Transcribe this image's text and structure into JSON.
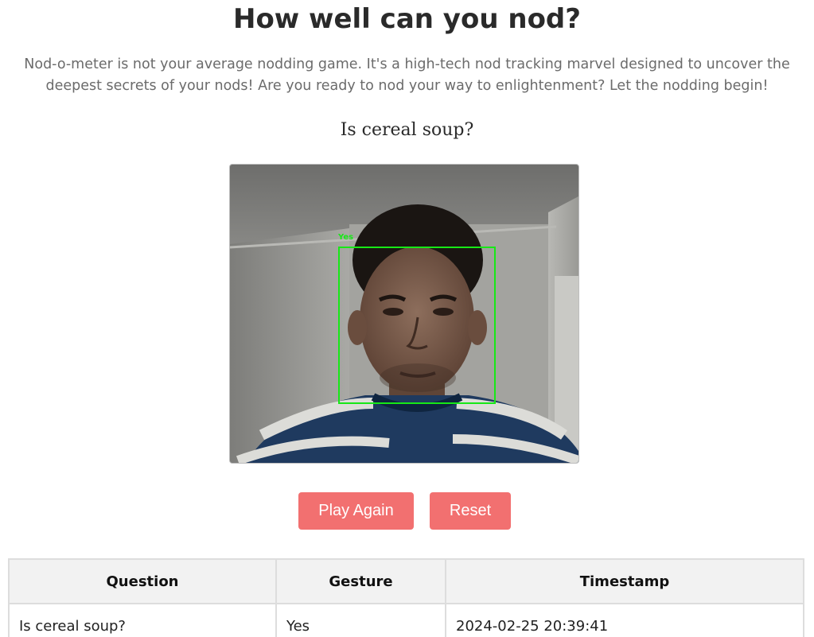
{
  "header": {
    "title": "How well can you nod?",
    "intro": "Nod-o-meter is not your average nodding game. It's a high-tech nod tracking marvel designed to uncover the deepest secrets of your nods! Are you ready to nod your way to enlightenment? Let the nodding begin!"
  },
  "game": {
    "question": "Is cereal soup?",
    "detection_label": "Yes",
    "detection_color": "#17e817"
  },
  "controls": {
    "play_again_label": "Play Again",
    "reset_label": "Reset",
    "button_color": "#f27070"
  },
  "history": {
    "columns": [
      "Question",
      "Gesture",
      "Timestamp"
    ],
    "rows": [
      [
        "Is cereal soup?",
        "Yes",
        "2024-02-25 20:39:41"
      ]
    ]
  }
}
